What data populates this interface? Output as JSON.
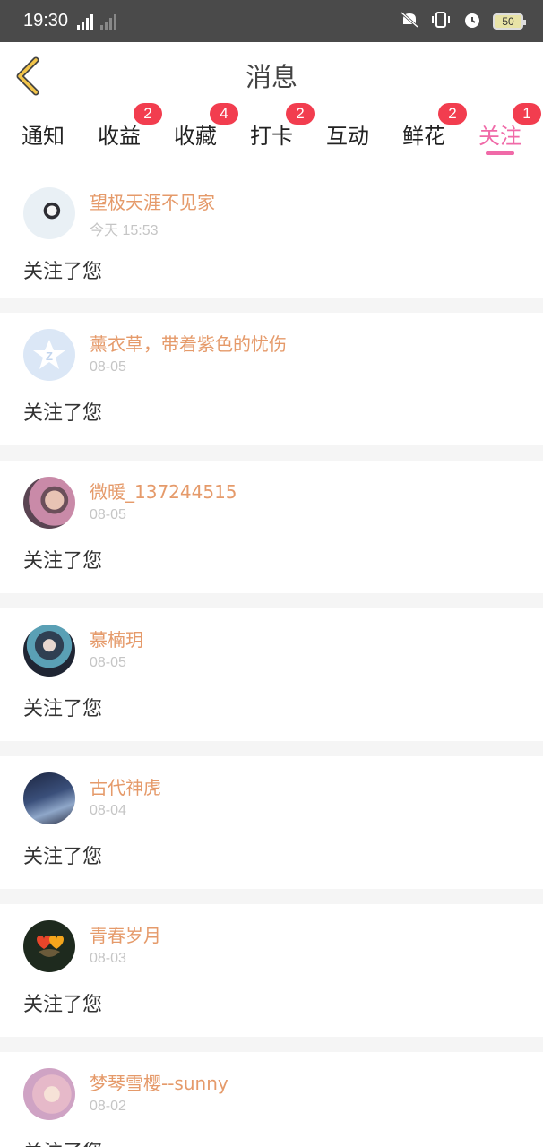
{
  "status": {
    "time": "19:30",
    "network": "4G",
    "battery": "50"
  },
  "header": {
    "title": "消息"
  },
  "tabs": [
    {
      "label": "通知",
      "badge": ""
    },
    {
      "label": "收益",
      "badge": "2"
    },
    {
      "label": "收藏",
      "badge": "4"
    },
    {
      "label": "打卡",
      "badge": "2"
    },
    {
      "label": "互动",
      "badge": ""
    },
    {
      "label": "鲜花",
      "badge": "2"
    },
    {
      "label": "关注",
      "badge": "1"
    }
  ],
  "active_tab": "关注",
  "items": [
    {
      "name": "望极天涯不见家",
      "date": "今天 15:53",
      "message": "关注了您",
      "avatar": "avatar-girl-white"
    },
    {
      "name": "薰衣草，带着紫色的忧伤",
      "date": "08-05",
      "message": "关注了您",
      "avatar": "avatar-default"
    },
    {
      "name": "微暖_137244515",
      "date": "08-05",
      "message": "关注了您",
      "avatar": "avatar-flowers"
    },
    {
      "name": "慕楠玥",
      "date": "08-05",
      "message": "关注了您",
      "avatar": "avatar-anime"
    },
    {
      "name": "古代神虎",
      "date": "08-04",
      "message": "关注了您",
      "avatar": "avatar-night-city"
    },
    {
      "name": "青春岁月",
      "date": "08-03",
      "message": "关注了您",
      "avatar": "avatar-hearts"
    },
    {
      "name": "梦琴雪樱--sunny",
      "date": "08-02",
      "message": "关注了您",
      "avatar": "avatar-pink"
    }
  ],
  "colors": {
    "accent": "#f06aa8",
    "badge": "#f23d4f",
    "name": "#e59a6a"
  }
}
